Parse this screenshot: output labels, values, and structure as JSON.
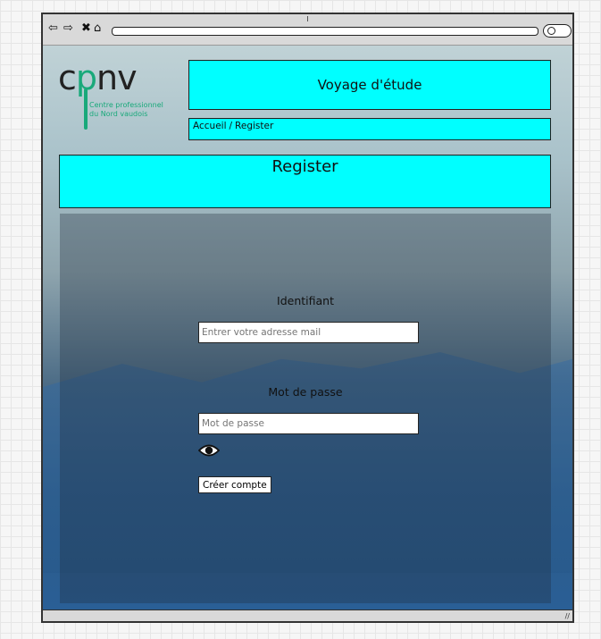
{
  "header": {
    "logo_letters": {
      "c": "c",
      "p": "p",
      "nv": "nv"
    },
    "logo_subtitle": "Centre professionnel\ndu Nord vaudois",
    "site_title": "Voyage d'étude"
  },
  "breadcrumb": {
    "home": "Accueil",
    "separator": "/",
    "current": "Register"
  },
  "page": {
    "heading": "Register"
  },
  "form": {
    "identifiant_label": "Identifiant",
    "email_placeholder": "Entrer votre adresse mail",
    "password_label": "Mot de passe",
    "password_placeholder": "Mot de passe",
    "submit_label": "Créer compte"
  },
  "icons": {
    "back": "back-arrow-icon",
    "forward": "forward-arrow-icon",
    "close": "close-icon",
    "home": "home-icon",
    "search": "search-icon",
    "eye": "eye-icon"
  },
  "colors": {
    "accent": "#00ffff",
    "brand_green": "#19a97a"
  }
}
